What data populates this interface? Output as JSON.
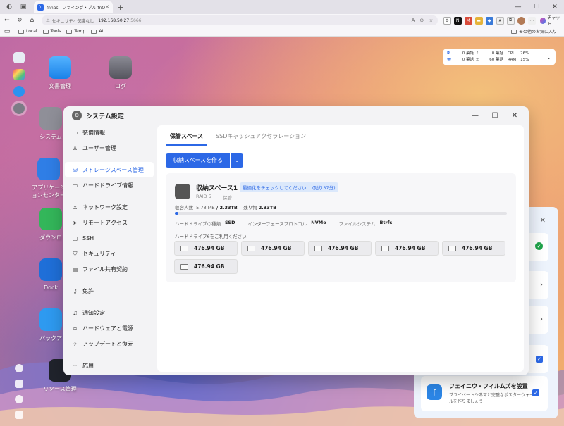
{
  "browser": {
    "tab_title": "fnnas - フライング・ブル fnOS",
    "tab_favicon": "fn",
    "url_insecure_label": "セキュリティ保護なし",
    "url_host": "192.168.50.27",
    "url_port": ":5666",
    "chat_label": "チャット",
    "bookmarks": [
      "Local",
      "Tools",
      "Temp",
      "AI"
    ],
    "other_favorites": "その他のお気に入り"
  },
  "monitor": {
    "r_label": "R",
    "w_label": "W",
    "r_up": "0 菓話",
    "w_up": "0 菓話",
    "r_down": "0 菓話",
    "w_down": "60 菓話",
    "cpu_label": "CPU",
    "ram_label": "RAM",
    "cpu_value": "26%",
    "ram_value": "15%"
  },
  "desktop_icons": {
    "files": "文書管理",
    "log": "ログ",
    "system": "システム",
    "appcenter": "アプリケーションセンター",
    "download": "ダウンロ",
    "docker": "Dock",
    "backup": "バックア",
    "resource": "リソース管理"
  },
  "window": {
    "title": "システム設定"
  },
  "sidebar": {
    "items": [
      {
        "label": "装備情報",
        "icon": "device-icon"
      },
      {
        "label": "ユーザー管理",
        "icon": "user-icon"
      },
      {
        "label": "ストレージスペース管理",
        "icon": "storage-icon",
        "active": true
      },
      {
        "label": "ハードドライブ情報",
        "icon": "harddrive-icon"
      },
      {
        "label": "ネットワーク設定",
        "icon": "network-icon"
      },
      {
        "label": "リモートアクセス",
        "icon": "remote-icon"
      },
      {
        "label": "SSH",
        "icon": "ssh-icon"
      },
      {
        "label": "セキュリティ",
        "icon": "shield-icon"
      },
      {
        "label": "ファイル共有契約",
        "icon": "share-icon"
      },
      {
        "label": "免許",
        "icon": "license-icon"
      },
      {
        "label": "通知設定",
        "icon": "bell-icon"
      },
      {
        "label": "ハードウェアと電源",
        "icon": "power-icon"
      },
      {
        "label": "アップデートと復元",
        "icon": "update-icon"
      },
      {
        "label": "応用",
        "icon": "apps-icon"
      }
    ]
  },
  "tabs": [
    "保管スペース",
    "SSDキャッシュアクセラレーション"
  ],
  "create_button": "収納スペースを作る",
  "pool": {
    "name": "収納スペース1",
    "badge": "最適化をチェックしてください... (残り37分)",
    "raid": "RAID 5",
    "state": "保管",
    "capacity_label": "収容人数",
    "used": "5.78 MB",
    "total": "/ 2.33TB",
    "remaining_label": "残り物",
    "remaining": "2.33TB",
    "usage_fraction": 0.002,
    "drive_type_label": "ハードドライブの種類",
    "drive_type": "SSD",
    "interface_label": "インターフェースプロトコル",
    "interface": "NVMe",
    "fs_label": "ファイルシステム",
    "fs": "Btrfs",
    "available_label": "ハードドライブ6をご利用ください",
    "disks": [
      "476.94 GB",
      "476.94 GB",
      "476.94 GB",
      "476.94 GB",
      "476.94 GB",
      "476.94 GB"
    ]
  },
  "notification": {
    "card_title": "フェイニウ・フィルムズを設置",
    "card_sub": "プライベートシネマと完璧なポスターウォールを作りましょう"
  },
  "colors": {
    "accent": "#2c68e6",
    "success": "#1fa34a"
  }
}
